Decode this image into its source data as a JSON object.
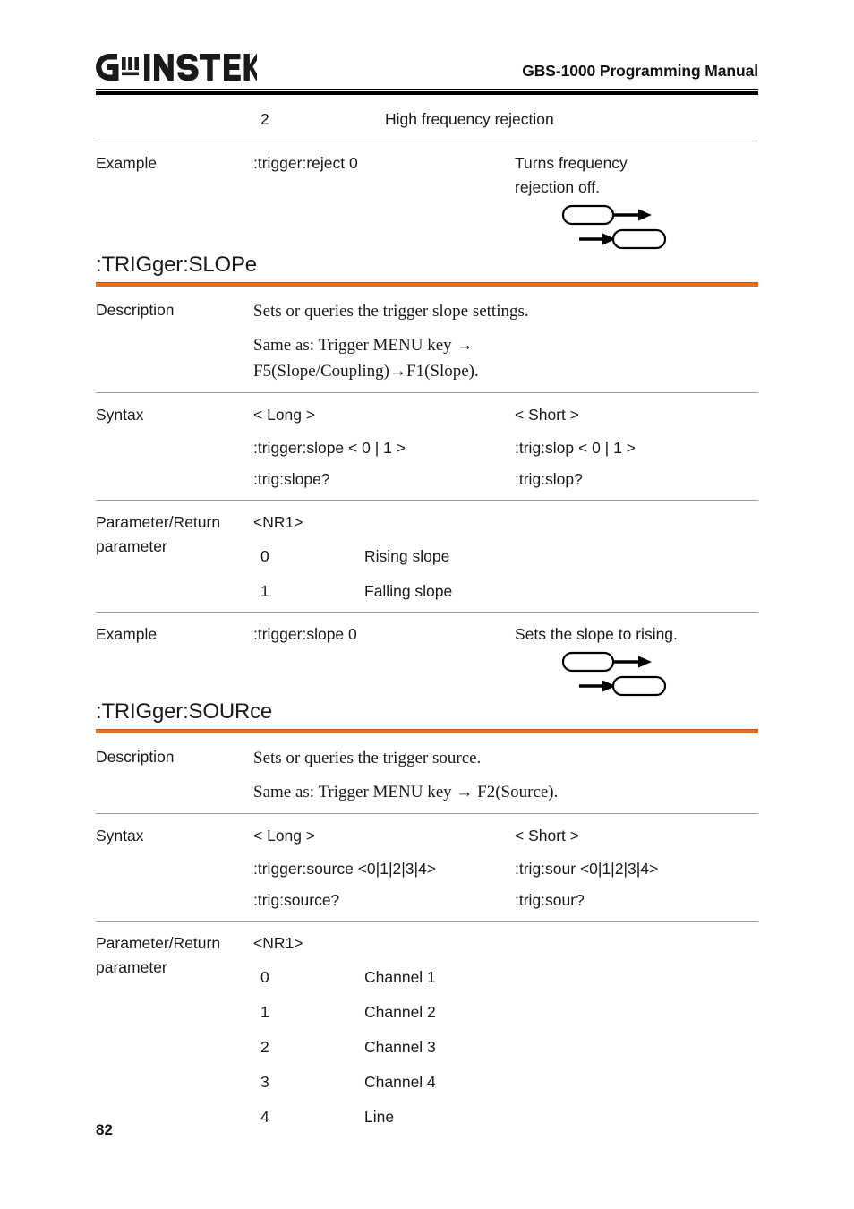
{
  "header": {
    "logo_text": "GW INSTEK",
    "logo_alt": "gw-instek-logo",
    "manual_title": "GBS-1000 Programming Manual"
  },
  "footer": {
    "page_number": "82"
  },
  "icons": {
    "command_icon": "command-pill-arrow-out-icon",
    "query_icon": "query-arrow-in-pill-icon"
  },
  "colors": {
    "accent_orange": "#e8701a",
    "accent_orange_dark": "#d4540c",
    "rule_gray": "#9a9a9a",
    "text": "#1a1a1a"
  },
  "continued_table": {
    "rows": [
      {
        "num": "2",
        "desc": "High frequency rejection"
      }
    ]
  },
  "reject_example": {
    "label": "Example",
    "command": ":trigger:reject 0",
    "result_line1": "Turns frequency",
    "result_line2": "rejection off."
  },
  "sections": [
    {
      "title": ":TRIGger:SLOPe",
      "description": {
        "label": "Description",
        "lines": [
          "Sets or queries the trigger slope settings.",
          "Same as: Trigger MENU key →",
          "F5(Slope/Coupling)→F1(Slope)."
        ]
      },
      "syntax": {
        "label": "Syntax",
        "long_header": "< Long >",
        "short_header": "< Short >",
        "long_lines": [
          ":trigger:slope < 0 | 1 >",
          ":trig:slope?"
        ],
        "short_lines": [
          ":trig:slop < 0 | 1 >",
          ":trig:slop?"
        ]
      },
      "parameter": {
        "label_line1": "Parameter/Return",
        "label_line2": "parameter",
        "type": "<NR1>",
        "rows": [
          {
            "num": "0",
            "desc": "Rising slope"
          },
          {
            "num": "1",
            "desc": "Falling slope"
          }
        ]
      },
      "example": {
        "label": "Example",
        "command": ":trigger:slope 0",
        "result": "Sets the slope to rising."
      }
    },
    {
      "title": ":TRIGger:SOURce",
      "description": {
        "label": "Description",
        "lines": [
          "Sets or queries the trigger source.",
          "Same as: Trigger MENU key → F2(Source)."
        ]
      },
      "syntax": {
        "label": "Syntax",
        "long_header": "< Long >",
        "short_header": "< Short >",
        "long_lines": [
          ":trigger:source <0|1|2|3|4>",
          ":trig:source?"
        ],
        "short_lines": [
          ":trig:sour <0|1|2|3|4>",
          ":trig:sour?"
        ]
      },
      "parameter": {
        "label_line1": "Parameter/Return",
        "label_line2": "parameter",
        "type": "<NR1>",
        "rows": [
          {
            "num": "0",
            "desc": "Channel 1"
          },
          {
            "num": "1",
            "desc": "Channel 2"
          },
          {
            "num": "2",
            "desc": "Channel 3"
          },
          {
            "num": "3",
            "desc": "Channel 4"
          },
          {
            "num": "4",
            "desc": "Line"
          }
        ]
      }
    }
  ]
}
